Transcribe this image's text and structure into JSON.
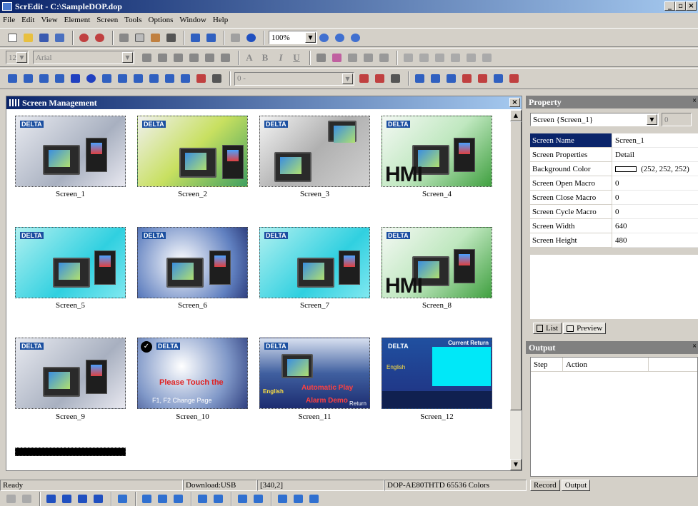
{
  "window": {
    "title": "ScrEdit - C:\\SampleDOP.dop",
    "btn_min": "_",
    "btn_max": "▫",
    "btn_close": "×"
  },
  "menu": [
    "File",
    "Edit",
    "View",
    "Element",
    "Screen",
    "Tools",
    "Options",
    "Window",
    "Help"
  ],
  "toolbar1": {
    "zoom_value": "100%",
    "zoom_icons": [
      "zoom-in-icon",
      "zoom-out-icon",
      "zoom-fit-icon"
    ]
  },
  "toolbar2": {
    "font_size": "12",
    "font_name": "Arial",
    "text_a": "A",
    "bold": "B",
    "italic": "I",
    "underline": "U"
  },
  "toolbar3": {
    "element_combo": "0 -"
  },
  "screen_management": {
    "title": "Screen Management",
    "close": "×",
    "screens": [
      {
        "name": "Screen_1",
        "style": "gray"
      },
      {
        "name": "Screen_2",
        "style": "green"
      },
      {
        "name": "Screen_3",
        "style": "gray3"
      },
      {
        "name": "Screen_4",
        "style": "hmi"
      },
      {
        "name": "Screen_5",
        "style": "cyan"
      },
      {
        "name": "Screen_6",
        "style": "blue"
      },
      {
        "name": "Screen_7",
        "style": "cyan"
      },
      {
        "name": "Screen_8",
        "style": "hmi"
      },
      {
        "name": "Screen_9",
        "style": "gray"
      },
      {
        "name": "Screen_10",
        "style": "blue10"
      },
      {
        "name": "Screen_11",
        "style": "blue11"
      },
      {
        "name": "Screen_12",
        "style": "blue12"
      }
    ],
    "screen10_text1": "Please Touch the",
    "screen10_text2": "F1, F2 Change Page",
    "screen11_text1": "English",
    "screen11_text2": "Automatic Play",
    "screen11_text3": "Alarm Demo",
    "screen11_text4": "Return",
    "screen12_title": "Current Return",
    "screen12_text": "English",
    "hmi_text": "HMI",
    "logo_text": "DELTA"
  },
  "property": {
    "title": "Property",
    "selector": "Screen {Screen_1}",
    "selector_num": "0",
    "rows": [
      {
        "key": "Screen Name",
        "value": "Screen_1"
      },
      {
        "key": "Screen Properties",
        "value": "Detail"
      },
      {
        "key": "Background Color",
        "value": "(252, 252, 252)"
      },
      {
        "key": "Screen Open Macro",
        "value": "0"
      },
      {
        "key": "Screen Close Macro",
        "value": "0"
      },
      {
        "key": "Screen Cycle Macro",
        "value": "0"
      },
      {
        "key": "Screen Width",
        "value": "640"
      },
      {
        "key": "Screen Height",
        "value": "480"
      }
    ],
    "tabs": [
      "List",
      "Preview"
    ],
    "background_color_hex": "#fcfcfc"
  },
  "output": {
    "title": "Output",
    "columns": [
      "Step",
      "Action"
    ],
    "tabs": [
      "Record",
      "Output"
    ]
  },
  "status": {
    "ready": "Ready",
    "download": "Download:USB",
    "coords": "[340,2]",
    "model": "DOP-AE80THTD 65536 Colors"
  }
}
